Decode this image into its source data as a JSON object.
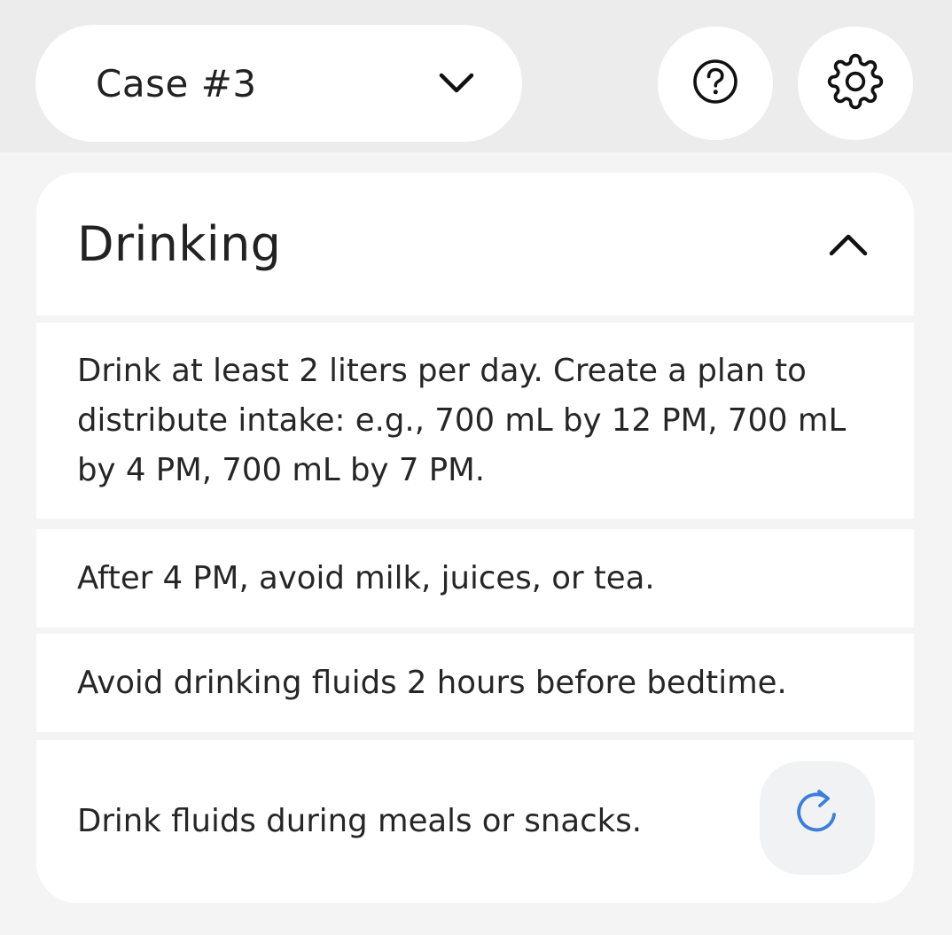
{
  "header": {
    "case_select": {
      "label": "Case #3",
      "icon": "chevron-down-icon"
    },
    "help_button": {
      "icon": "help-circle-icon"
    },
    "settings_button": {
      "icon": "gear-icon"
    }
  },
  "section": {
    "title": "Drinking",
    "toggle_icon": "chevron-up-icon",
    "items": [
      {
        "text": "Drink at least 2 liters per day. Create a plan to distribute intake: e.g., 700 mL by 12 PM, 700 mL by 4 PM, 700 mL by 7 PM."
      },
      {
        "text": "After 4 PM, avoid milk, juices, or tea."
      },
      {
        "text": "Avoid drinking fluids 2 hours before bedtime."
      },
      {
        "text": "Drink fluids during meals or snacks.",
        "action_icon": "refresh-icon"
      }
    ]
  },
  "colors": {
    "background": "#f4f4f4",
    "topbar": "#ececec",
    "surface": "#ffffff",
    "text": "#222222",
    "accent": "#3b7fd9"
  }
}
